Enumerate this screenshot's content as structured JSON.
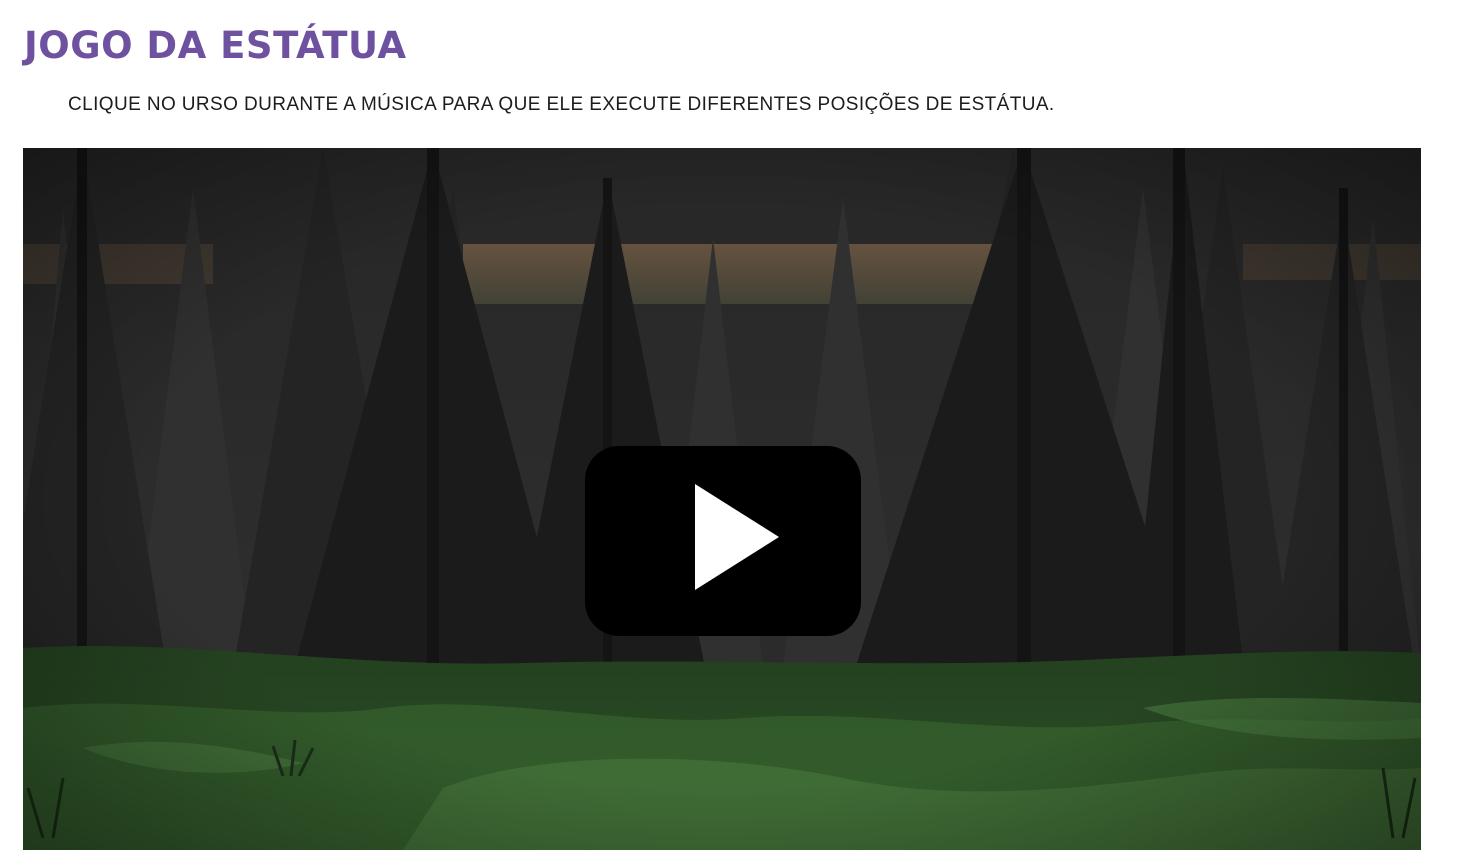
{
  "header": {
    "title": "JOGO DA ESTÁTUA",
    "instructions": "CLIQUE NO URSO DURANTE A MÚSICA PARA QUE ELE EXECUTE DIFERENTES POSIÇÕES DE ESTÁTUA."
  },
  "video": {
    "icon": "play-icon",
    "scene": "night-forest",
    "colors": {
      "sky": "#2b2b2b",
      "trees": "#1c1c1c",
      "dusk_glow": "#8a6e4f",
      "grass_dark": "#1f3a1a",
      "grass_light": "#3f6b35",
      "play_button": "#000000"
    }
  }
}
